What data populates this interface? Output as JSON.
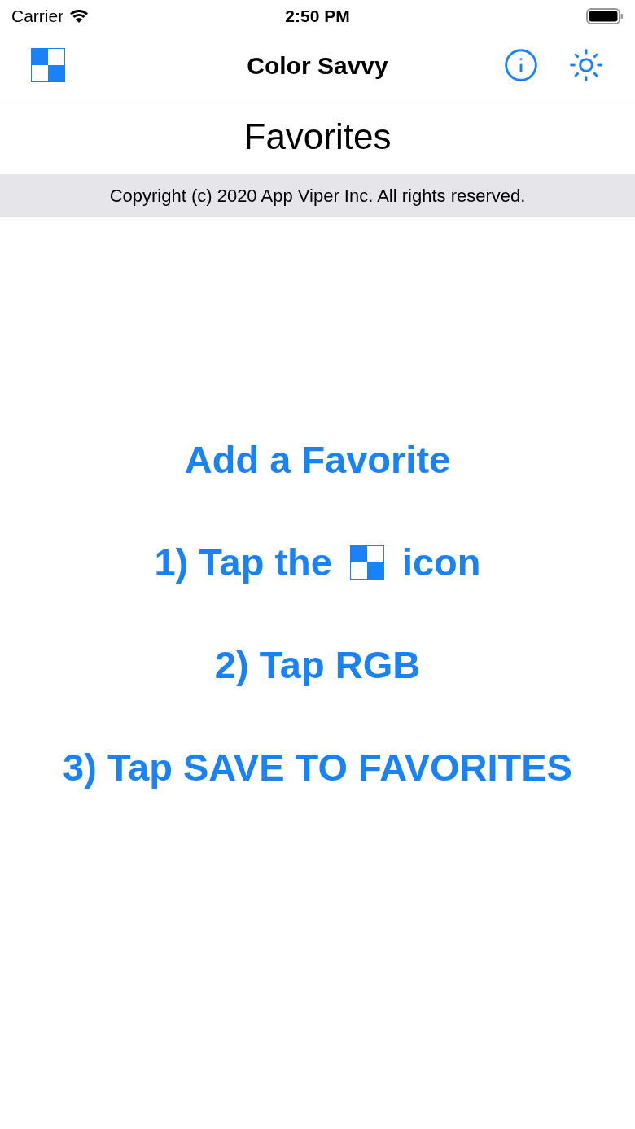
{
  "status_bar": {
    "carrier": "Carrier",
    "time": "2:50 PM"
  },
  "nav_bar": {
    "title": "Color Savvy"
  },
  "page_title": "Favorites",
  "copyright": "Copyright (c) 2020 App Viper Inc. All rights reserved.",
  "heading": "Add a Favorite",
  "steps": [
    {
      "kind": "with_icon",
      "text": "1) Tap the",
      "after": "icon"
    },
    {
      "kind": "text",
      "text": "2) Tap RGB"
    },
    {
      "kind": "text",
      "text": "3) Tap SAVE TO FAVORITES"
    }
  ]
}
